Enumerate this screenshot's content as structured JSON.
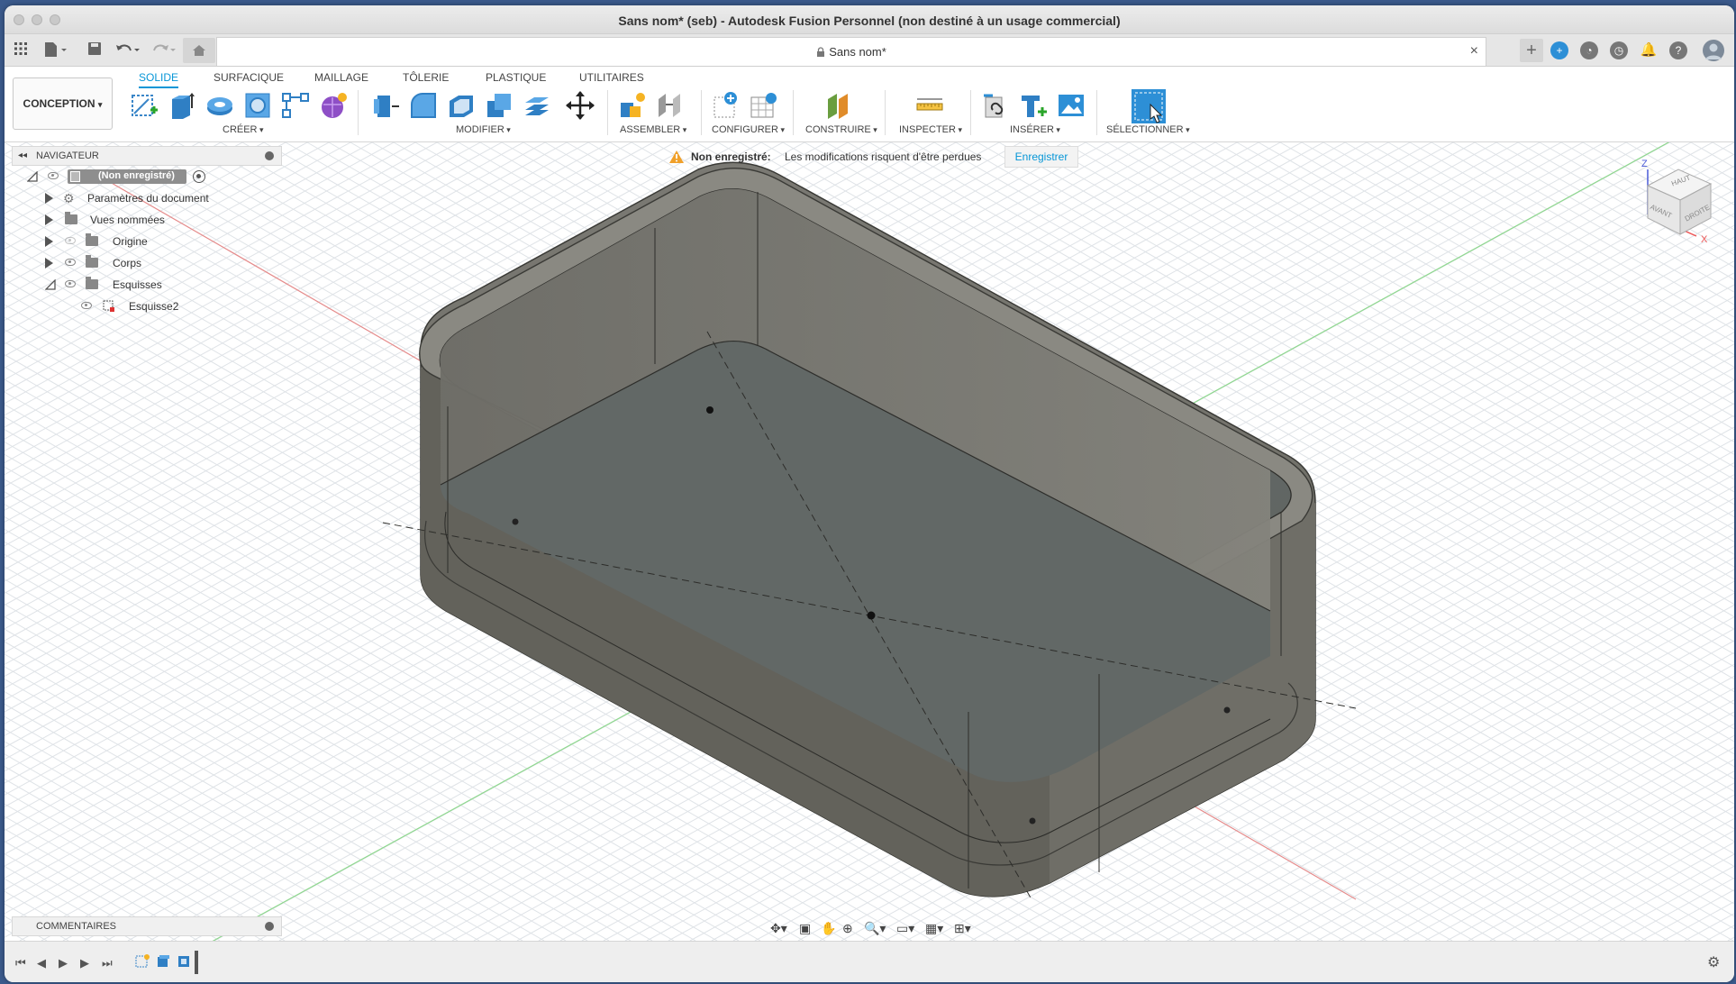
{
  "window": {
    "title": "Sans nom* (seb) - Autodesk Fusion Personnel (non destiné à un usage commercial)"
  },
  "doc_tab": {
    "label": "Sans nom*",
    "lock_icon": "lock-icon"
  },
  "ribbon": {
    "workspace": "CONCEPTION",
    "tabs": [
      "SOLIDE",
      "SURFACIQUE",
      "MAILLAGE",
      "TÔLERIE",
      "PLASTIQUE",
      "UTILITAIRES"
    ],
    "active_tab": "SOLIDE",
    "groups": [
      "CRÉER",
      "MODIFIER",
      "ASSEMBLER",
      "CONFIGURER",
      "CONSTRUIRE",
      "INSPECTER",
      "INSÉRER",
      "SÉLECTIONNER"
    ]
  },
  "navigator": {
    "title": "NAVIGATEUR",
    "root": "(Non enregistré)",
    "items": [
      {
        "label": "Paramètres du document",
        "icon": "gear-icon"
      },
      {
        "label": "Vues nommées",
        "icon": "folder-icon"
      },
      {
        "label": "Origine",
        "icon": "folder-icon"
      },
      {
        "label": "Corps",
        "icon": "folder-icon"
      },
      {
        "label": "Esquisses",
        "icon": "folder-icon"
      },
      {
        "label": "Esquisse2",
        "icon": "sketch-icon"
      }
    ]
  },
  "banner": {
    "label": "Non enregistré:",
    "message": "Les modifications risquent d'être perdues",
    "button": "Enregistrer"
  },
  "viewcube": {
    "top": "HAUT",
    "front": "AVANT",
    "right": "DROITE",
    "axis_x": "X",
    "axis_z": "Z"
  },
  "comments": {
    "title": "COMMENTAIRES"
  },
  "colors": {
    "accent": "#0696d7",
    "model": "#6f6e68",
    "grid": "#d8dde2"
  }
}
